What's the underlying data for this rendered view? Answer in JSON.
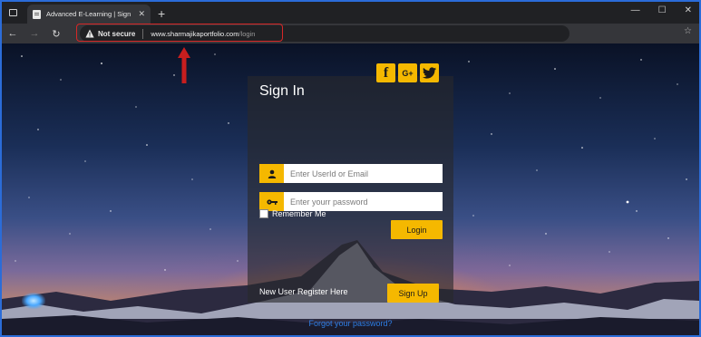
{
  "browser": {
    "tab": {
      "title": "Advanced E-Learning | Sign In",
      "close_glyph": "✕"
    },
    "new_tab_glyph": "+",
    "window_controls": {
      "minimize": "—",
      "maximize": "☐",
      "close": "✕"
    },
    "nav": {
      "back": "←",
      "forward": "→",
      "reload": "↻"
    },
    "address": {
      "security_label": "Not secure",
      "host": "www.sharmajikaportfolio.com",
      "path": "/login"
    },
    "favorites_glyph": "☆"
  },
  "annotation": {
    "color": "#d62727"
  },
  "login_card": {
    "title": "Sign In",
    "social": {
      "facebook": "f",
      "google_plus": "G+",
      "twitter": "twitter-bird"
    },
    "userid_field": {
      "placeholder": "Enter UserId or Email",
      "value": ""
    },
    "password_field": {
      "placeholder": "Enter yourr password",
      "value": ""
    },
    "remember_label": "Remember Me",
    "remember_checked": false,
    "login_label": "Login",
    "register_text": "New User Register Here",
    "signup_label": "Sign Up",
    "forgot_link": "Forgot your password?"
  },
  "colors": {
    "accent": "#f5b800",
    "link": "#2f7fe6",
    "card_bg": "rgba(40,40,44,0.62)"
  }
}
